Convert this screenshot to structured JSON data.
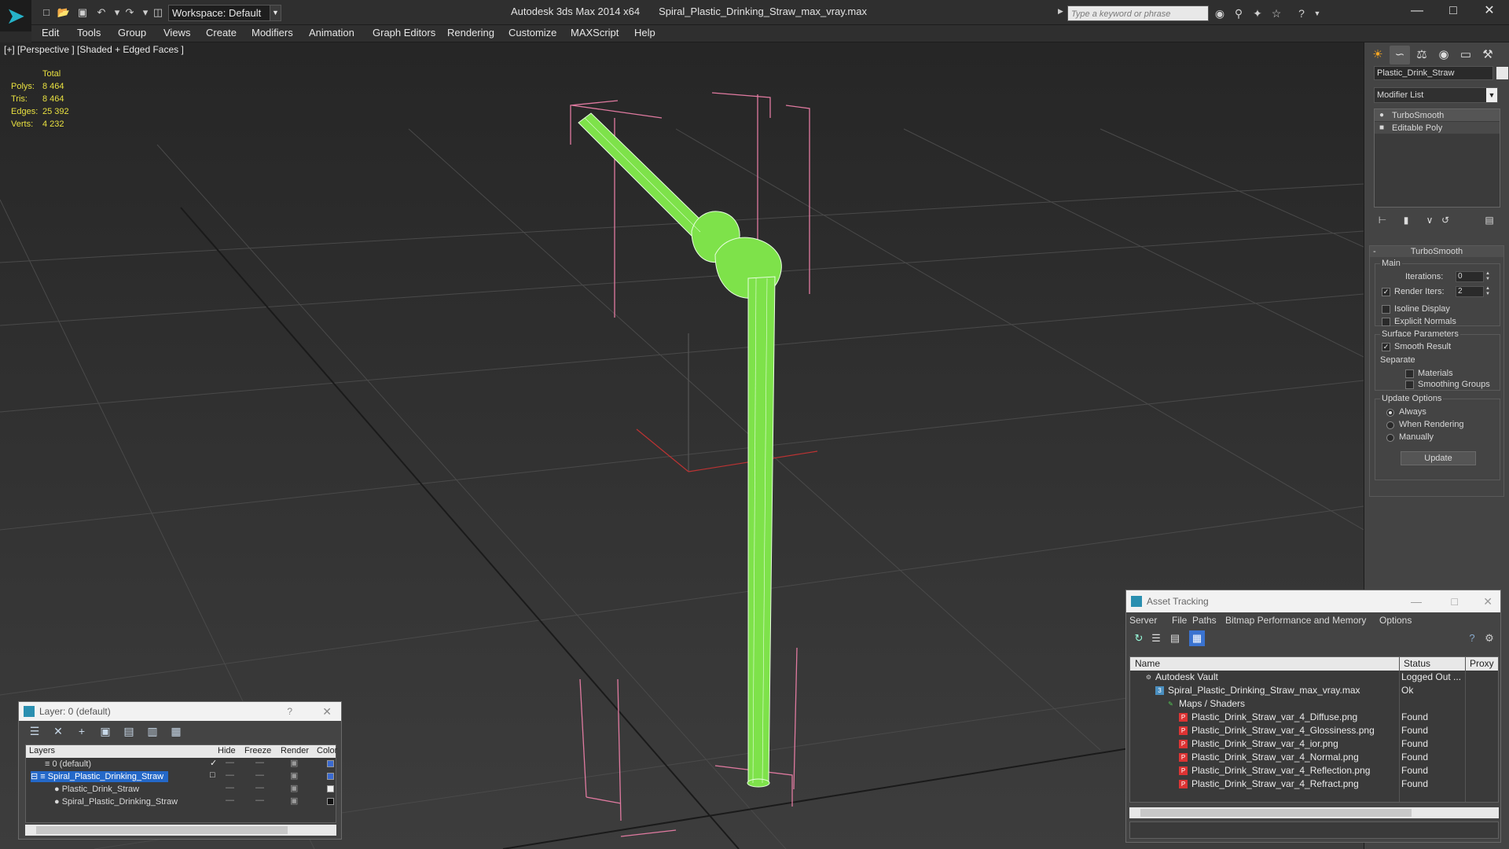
{
  "app": {
    "title": "Autodesk 3ds Max  2014 x64",
    "filename": "Spiral_Plastic_Drinking_Straw_max_vray.max",
    "workspace": "Workspace: Default",
    "search_placeholder": "Type a keyword or phrase"
  },
  "menu": [
    "Edit",
    "Tools",
    "Group",
    "Views",
    "Create",
    "Modifiers",
    "Animation",
    "Graph Editors",
    "Rendering",
    "Customize",
    "MAXScript",
    "Help"
  ],
  "viewport": {
    "label": "[+] [Perspective ] [Shaded + Edged Faces ]",
    "stats_header": "Total",
    "stats": [
      {
        "label": "Polys:",
        "value": "8 464"
      },
      {
        "label": "Tris:",
        "value": "8 464"
      },
      {
        "label": "Edges:",
        "value": "25 392"
      },
      {
        "label": "Verts:",
        "value": "4 232"
      }
    ]
  },
  "command_panel": {
    "object_name": "Plastic_Drink_Straw",
    "modifier_list": "Modifier List",
    "stack": [
      "TurboSmooth",
      "Editable Poly"
    ],
    "rollout_title": "TurboSmooth",
    "main_group": "Main",
    "iterations_label": "Iterations:",
    "iterations_value": "0",
    "render_iters_label": "Render Iters:",
    "render_iters_value": "2",
    "isoline": "Isoline Display",
    "explicit_normals": "Explicit Normals",
    "surface_group": "Surface Parameters",
    "smooth_result": "Smooth Result",
    "separate": "Separate",
    "materials": "Materials",
    "smoothing_groups": "Smoothing Groups",
    "update_group": "Update Options",
    "always": "Always",
    "when_rendering": "When Rendering",
    "manually": "Manually",
    "update_button": "Update"
  },
  "layer_window": {
    "title": "Layer: 0 (default)",
    "columns": {
      "layers": "Layers",
      "hide": "Hide",
      "freeze": "Freeze",
      "render": "Render",
      "color": "Color"
    },
    "rows": [
      {
        "name": "0 (default)",
        "color": "#3a6ad0"
      },
      {
        "name": "Spiral_Plastic_Drinking_Straw",
        "color": "#3a6ad0"
      },
      {
        "name": "Plastic_Drink_Straw",
        "color": "#f0f0f0"
      },
      {
        "name": "Spiral_Plastic_Drinking_Straw",
        "color": "#111111"
      }
    ]
  },
  "asset_window": {
    "title": "Asset Tracking",
    "menu": [
      "Server",
      "File",
      "Paths",
      "Bitmap Performance and Memory",
      "Options"
    ],
    "columns": {
      "name": "Name",
      "status": "Status",
      "proxy": "Proxy"
    },
    "rows": [
      {
        "name": "Autodesk Vault",
        "status": "Logged Out ..."
      },
      {
        "name": "Spiral_Plastic_Drinking_Straw_max_vray.max",
        "status": "Ok"
      },
      {
        "name": "Maps / Shaders",
        "status": ""
      },
      {
        "name": "Plastic_Drink_Straw_var_4_Diffuse.png",
        "status": "Found"
      },
      {
        "name": "Plastic_Drink_Straw_var_4_Glossiness.png",
        "status": "Found"
      },
      {
        "name": "Plastic_Drink_Straw_var_4_ior.png",
        "status": "Found"
      },
      {
        "name": "Plastic_Drink_Straw_var_4_Normal.png",
        "status": "Found"
      },
      {
        "name": "Plastic_Drink_Straw_var_4_Reflection.png",
        "status": "Found"
      },
      {
        "name": "Plastic_Drink_Straw_var_4_Refract.png",
        "status": "Found"
      }
    ]
  },
  "colors": {
    "straw": "#7ee24a",
    "bbox": "#e07aa0",
    "stats": "#e8e040",
    "selection": "#2468c8"
  }
}
